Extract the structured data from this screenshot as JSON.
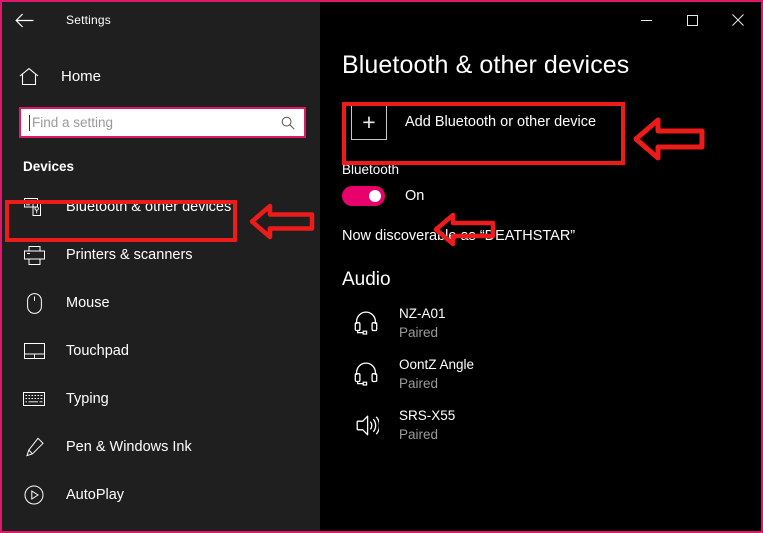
{
  "window": {
    "title": "Settings",
    "back_icon": "back-arrow-icon",
    "minimize_label": "—",
    "maximize_label": "□",
    "close_label": "✕",
    "border_color": "#E0186C"
  },
  "sidebar": {
    "home": {
      "label": "Home",
      "icon": "home-icon"
    },
    "search": {
      "value": "",
      "placeholder": "Find a setting",
      "icon": "search-icon"
    },
    "section_title": "Devices",
    "items": [
      {
        "label": "Bluetooth & other devices",
        "icon": "bluetooth-devices-icon",
        "selected": true
      },
      {
        "label": "Printers & scanners",
        "icon": "printer-icon",
        "selected": false
      },
      {
        "label": "Mouse",
        "icon": "mouse-icon",
        "selected": false
      },
      {
        "label": "Touchpad",
        "icon": "touchpad-icon",
        "selected": false
      },
      {
        "label": "Typing",
        "icon": "keyboard-icon",
        "selected": false
      },
      {
        "label": "Pen & Windows Ink",
        "icon": "pen-icon",
        "selected": false
      },
      {
        "label": "AutoPlay",
        "icon": "autoplay-icon",
        "selected": false
      }
    ]
  },
  "main": {
    "page_title": "Bluetooth & other devices",
    "add_device": {
      "label": "Add Bluetooth or other device",
      "icon": "plus-icon"
    },
    "bluetooth": {
      "label": "Bluetooth",
      "toggle_state": "On",
      "toggle_on": true,
      "toggle_color": "#E8006B",
      "discoverable_text": "Now discoverable as “DEATHSTAR”"
    },
    "audio": {
      "group_title": "Audio",
      "devices": [
        {
          "name": "NZ-A01",
          "status": "Paired",
          "icon": "headset-icon"
        },
        {
          "name": "OontZ Angle",
          "status": "Paired",
          "icon": "headset-icon"
        },
        {
          "name": "SRS-X55",
          "status": "Paired",
          "icon": "speaker-icon"
        }
      ]
    }
  },
  "annotations": {
    "color": "#EE1B1B",
    "boxes": [
      {
        "name": "add-device-highlight"
      },
      {
        "name": "bluetooth-nav-highlight"
      }
    ],
    "arrows": [
      {
        "name": "arrow-to-add-device"
      },
      {
        "name": "arrow-to-toggle"
      },
      {
        "name": "arrow-to-bluetooth-nav"
      }
    ]
  }
}
